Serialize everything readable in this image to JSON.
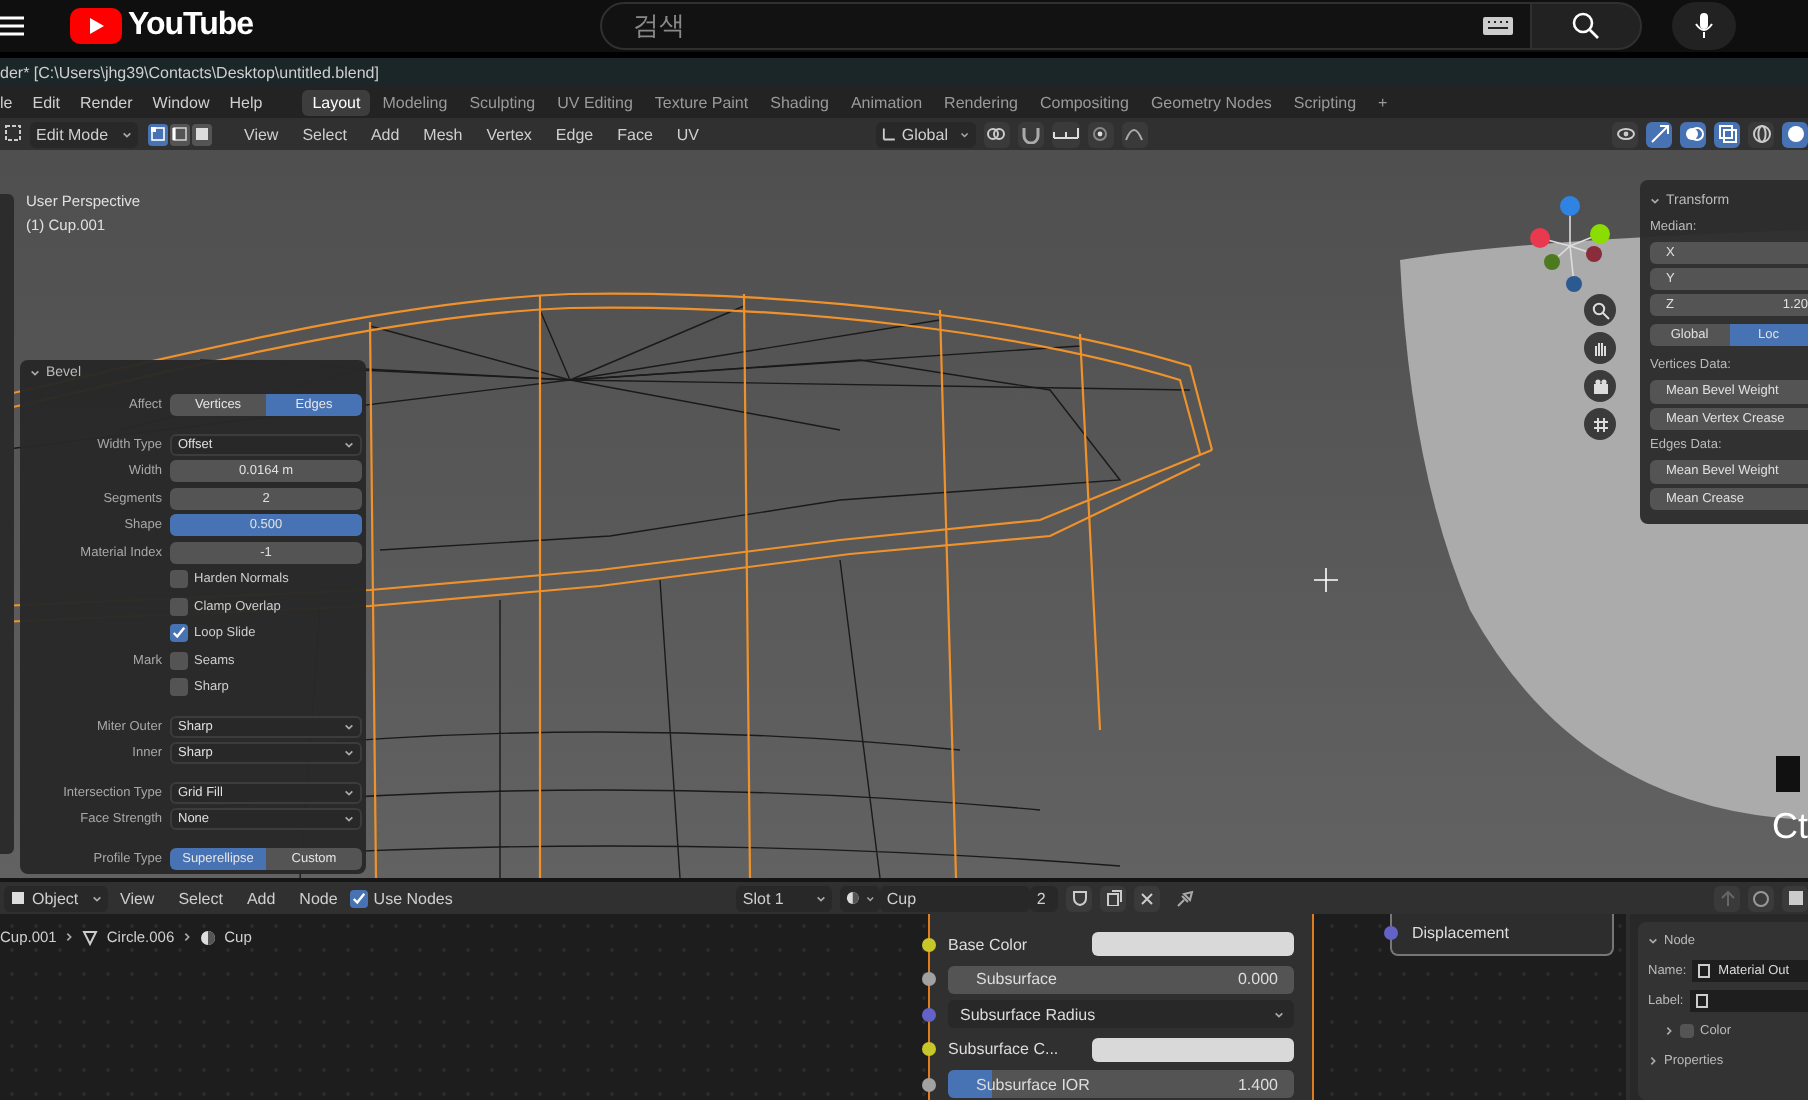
{
  "youtube": {
    "logo": "YouTube",
    "search": {
      "placeholder": "검색"
    }
  },
  "title_bar": {
    "title": "der* [C:\\Users\\jhg39\\Contacts\\Desktop\\untitled.blend]"
  },
  "menu": [
    "le",
    "Edit",
    "Render",
    "Window",
    "Help"
  ],
  "workspaces": [
    {
      "label": "Layout",
      "selected": true
    },
    {
      "label": "Modeling",
      "selected": false
    },
    {
      "label": "Sculpting",
      "selected": false
    },
    {
      "label": "UV Editing",
      "selected": false
    },
    {
      "label": "Texture Paint",
      "selected": false
    },
    {
      "label": "Shading",
      "selected": false
    },
    {
      "label": "Animation",
      "selected": false
    },
    {
      "label": "Rendering",
      "selected": false
    },
    {
      "label": "Compositing",
      "selected": false
    },
    {
      "label": "Geometry Nodes",
      "selected": false
    },
    {
      "label": "Scripting",
      "selected": false
    }
  ],
  "workspace_add": "+",
  "header": {
    "mode": "Edit Mode",
    "select_modes": [
      {
        "selected": true
      },
      {
        "selected": false
      },
      {
        "selected": false
      }
    ],
    "menus": [
      "View",
      "Select",
      "Add",
      "Mesh",
      "Vertex",
      "Edge",
      "Face",
      "UV"
    ],
    "orientation": "Global"
  },
  "viewport": {
    "view_name": "User Perspective",
    "object": "(1) Cup.001",
    "caption": "Ct"
  },
  "bevel": {
    "title": "Bevel",
    "sections": [
      [
        {
          "kind": "toggle",
          "label": "Affect",
          "options": [
            {
              "label": "Vertices",
              "selected": false
            },
            {
              "label": "Edges",
              "selected": true
            }
          ]
        }
      ],
      [
        {
          "kind": "dropdown",
          "label": "Width Type",
          "value": "Offset"
        },
        {
          "kind": "number",
          "label": "Width",
          "value": "0.0164 m"
        },
        {
          "kind": "number",
          "label": "Segments",
          "value": "2"
        },
        {
          "kind": "slider",
          "label": "Shape",
          "value": "0.500",
          "level": 1
        },
        {
          "kind": "number",
          "label": "Material Index",
          "value": "-1"
        },
        {
          "kind": "checkbox",
          "text": "Harden Normals",
          "checked": false
        },
        {
          "kind": "checkbox",
          "text": "Clamp Overlap",
          "checked": false
        },
        {
          "kind": "checkbox",
          "text": "Loop Slide",
          "checked": true
        },
        {
          "kind": "checkbox",
          "label": "Mark",
          "text": "Seams",
          "checked": false
        },
        {
          "kind": "checkbox",
          "text": "Sharp",
          "checked": false
        }
      ],
      [
        {
          "kind": "dropdown",
          "label": "Miter Outer",
          "value": "Sharp"
        },
        {
          "kind": "dropdown",
          "label": "Inner",
          "value": "Sharp"
        }
      ],
      [
        {
          "kind": "dropdown",
          "label": "Intersection Type",
          "value": "Grid Fill"
        },
        {
          "kind": "dropdown",
          "label": "Face Strength",
          "value": "None"
        }
      ],
      [
        {
          "kind": "toggle",
          "label": "Profile Type",
          "options": [
            {
              "label": "Superellipse",
              "selected": true
            },
            {
              "label": "Custom",
              "selected": false
            }
          ]
        }
      ]
    ]
  },
  "transform": {
    "title": "Transform",
    "median": "Median:",
    "axes": [
      {
        "label": "X"
      },
      {
        "label": "Y"
      },
      {
        "label": "Z",
        "value": "1.20"
      }
    ],
    "space": [
      {
        "label": "Global",
        "selected": false
      },
      {
        "label": "Loc",
        "selected": true
      }
    ],
    "groups": [
      {
        "title": "Vertices Data:",
        "buttons": [
          "Mean Bevel Weight",
          "Mean Vertex Crease"
        ]
      },
      {
        "title": "Edges Data:",
        "buttons": [
          "Mean Bevel Weight",
          "Mean Crease"
        ]
      }
    ]
  },
  "node_editor": {
    "mode": "Object",
    "menus": [
      "View",
      "Select",
      "Add",
      "Node"
    ],
    "use_nodes": {
      "label": "Use Nodes",
      "checked": true
    },
    "slot": "Slot 1",
    "material": "Cup",
    "users": "2",
    "breadcrumb": [
      "Cup.001",
      "Circle.006",
      "Cup"
    ],
    "bsdf": {
      "rows": [
        {
          "kind": "color",
          "label": "Base Color",
          "color": "#c7c729"
        },
        {
          "kind": "number",
          "label": "Subsurface",
          "value": "0.000",
          "color": "#a1a1a1"
        },
        {
          "kind": "dropdown",
          "label": "Subsurface Radius",
          "color": "#6363c7"
        },
        {
          "kind": "color",
          "label": "Subsurface C...",
          "color": "#c7c729"
        },
        {
          "kind": "slider",
          "label": "Subsurface IOR",
          "value": "1.400",
          "level": 0.13,
          "color": "#a1a1a1"
        }
      ]
    },
    "output": {
      "socket": "Displacement",
      "color": "#6363c7"
    },
    "sidebar": {
      "title": "Node",
      "name_label": "Name:",
      "name": "Material Out",
      "label_label": "Label:",
      "color": {
        "label": "Color",
        "checked": false
      },
      "properties": "Properties"
    }
  }
}
